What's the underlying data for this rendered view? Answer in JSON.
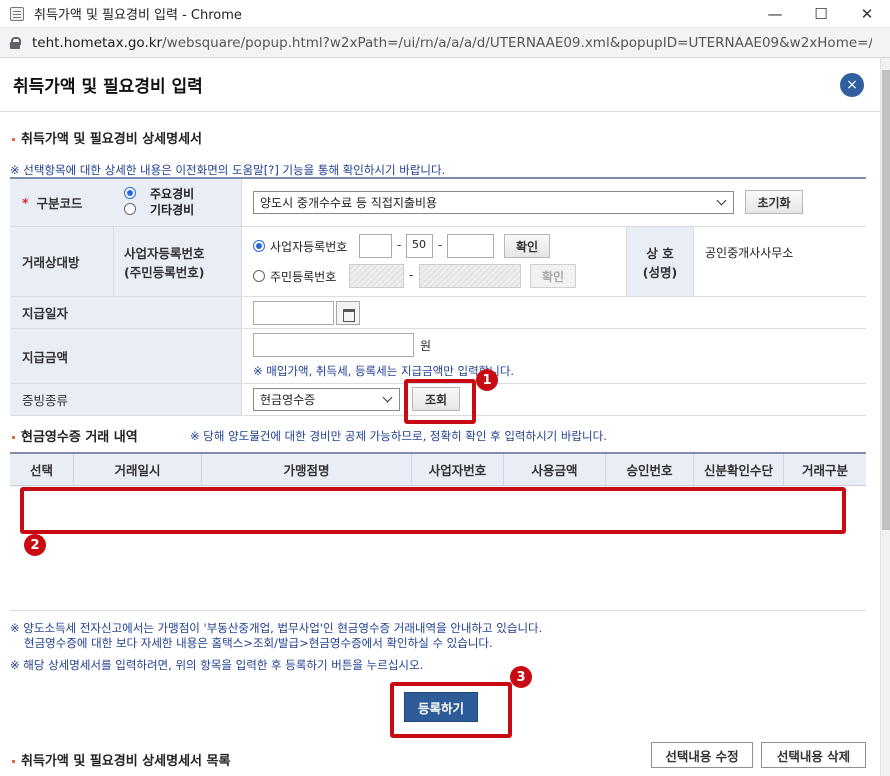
{
  "window": {
    "title": "취득가액 및 필요경비 입력 - Chrome",
    "url_host": "teht.hometax.go.kr",
    "url_path": "/websquare/popup.html?w2xPath=/ui/rn/a/a/a/d/UTERNAAE09.xml&popupID=UTERNAAE09&w2xHome=/ui/rn/z..."
  },
  "popup": {
    "title": "취득가액 및 필요경비 입력",
    "close_label": "×"
  },
  "section1": {
    "title": "취득가액 및 필요경비 상세명세서",
    "note": "※ 선택항목에 대한 상세한 내용은 이전화면의 도움말[?] 기능을 통해 확인하시기 바랍니다."
  },
  "form": {
    "category_code": {
      "label": "구분코드",
      "required_mark": "*",
      "options": [
        "주요경비",
        "기타경비"
      ],
      "selected": "주요경비",
      "dropdown_value": "양도시 중개수수료 등 직접지출비용",
      "reset_label": "초기화"
    },
    "counterparty": {
      "label": "거래상대방",
      "id_label_line1": "사업자등록번호",
      "id_label_line2": "(주민등록번호)",
      "biz_radio_label": "사업자등록번호",
      "biz_part1": "",
      "biz_part2": "50",
      "biz_part3": "",
      "biz_confirm": "확인",
      "resident_radio_label": "주민등록번호",
      "resident_confirm": "확인",
      "name_label_line1": "상 호",
      "name_label_line2": "(성명)",
      "name_value": "공인중개사사무소"
    },
    "pay_date": {
      "label": "지급일자",
      "value": ""
    },
    "pay_amount": {
      "label": "지급금액",
      "value": "",
      "unit": "원",
      "note": "※ 매입가액, 취득세, 등록세는 지급금액만 입력합니다."
    },
    "evidence": {
      "label": "증빙종류",
      "value": "현금영수증",
      "search_label": "조회"
    }
  },
  "section2": {
    "title": "현금영수증 거래 내역",
    "note": "※ 당해 양도물건에 대한 경비만 공제 가능하므로, 정확히 확인 후 입력하시기 바랍니다.",
    "columns": [
      "선택",
      "거래일시",
      "가맹점명",
      "사업자번호",
      "사용금액",
      "승인번호",
      "신분확인수단",
      "거래구분"
    ]
  },
  "footer": {
    "note1_line1": "※ 양도소득세 전자신고에서는 가맹점이 '부동산중개업, 법무사업'인 현금영수증 거래내역을 안내하고 있습니다.",
    "note1_line2": "현금영수증에 대한 보다 자세한 내용은 홈택스>조회/발급>현금영수증에서 확인하실 수 있습니다.",
    "note2": "※ 해당 상세명세서를 입력하려면, 위의 항목을 입력한 후 등록하기 버튼을 누르십시오.",
    "register_label": "등록하기"
  },
  "section3": {
    "title": "취득가액 및 필요경비 상세명세서 목록",
    "edit_label": "선택내용 수정",
    "delete_label": "선택내용 삭제"
  },
  "annotations": {
    "badge1": "1",
    "badge2": "2",
    "badge3": "3",
    "highlight_color": "#c80b12"
  }
}
